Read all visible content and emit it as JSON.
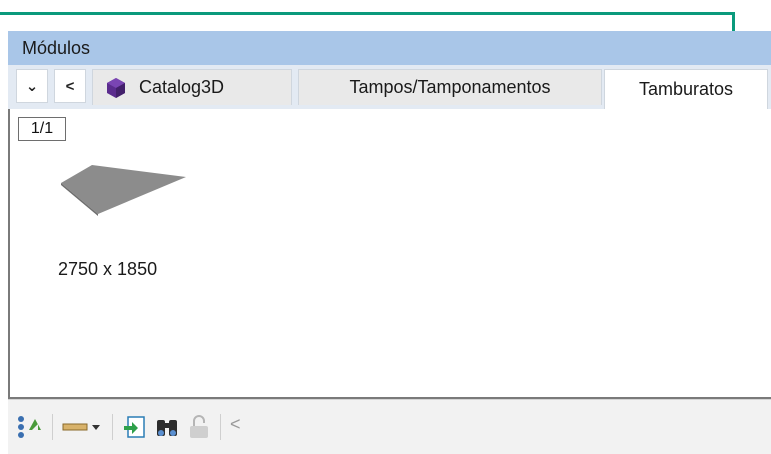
{
  "panel": {
    "title": "Módulos"
  },
  "tabs": {
    "nav_down_glyph": "⌄",
    "nav_left_glyph": "<",
    "items": [
      {
        "label": "Catalog3D",
        "icon": "cube-icon",
        "icon_color": "#5b2c8e"
      },
      {
        "label": "Tampos/Tamponamentos"
      },
      {
        "label": "Tamburatos",
        "active": true
      }
    ]
  },
  "content": {
    "pager": "1/1",
    "items": [
      {
        "label": "2750 x 1850",
        "thumbnail": "gray-panel-thumbnail"
      }
    ]
  },
  "toolbar": {
    "icons": [
      "tree-refresh-icon",
      "dimension-dropdown-icon",
      "import-icon",
      "binoculars-icon",
      "lock-icon"
    ],
    "scroll_glyph": "<"
  },
  "colors": {
    "accent": "#0a9a7c",
    "title_bar": "#a9c6e8"
  }
}
